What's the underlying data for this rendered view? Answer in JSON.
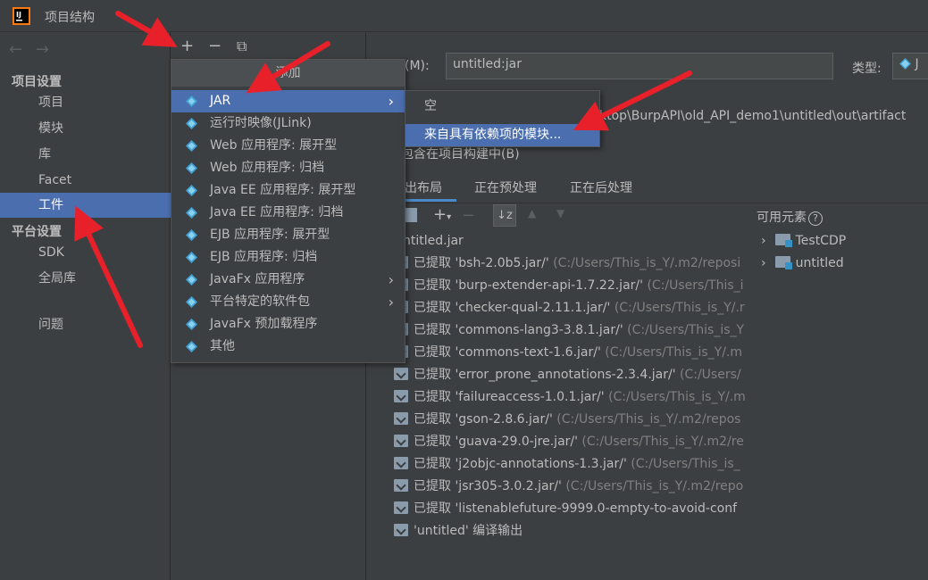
{
  "window": {
    "title": "项目结构"
  },
  "left": {
    "section1": "项目设置",
    "section2": "平台设置",
    "items1": [
      "项目",
      "模块",
      "库",
      "Facet",
      "工件"
    ],
    "items2": [
      "SDK",
      "全局库"
    ],
    "problems": "问题",
    "nav_back": "←",
    "nav_forward": "→"
  },
  "mid_toolbar": {
    "add": "+",
    "remove": "−",
    "copy": "⧉"
  },
  "right": {
    "name_label": "(M):",
    "name_mnemonic": "M",
    "name_value": "untitled:jar",
    "type_label": "类型:",
    "type_value": "J",
    "output_value": "ktop\\BurpAPI\\old_API_demo1\\untitled\\out\\artifact",
    "include_label": "包含在项目构建中",
    "include_key": "B",
    "tabs": [
      "出布局",
      "正在预处理",
      "正在后处理"
    ],
    "available_label": "可用元素",
    "root": "ntitled.jar",
    "rows": [
      {
        "name": "已提取 'bsh-2.0b5.jar/'",
        "path": "(C:/Users/This_is_Y/.m2/reposi"
      },
      {
        "name": "已提取 'burp-extender-api-1.7.22.jar/'",
        "path": "(C:/Users/This_i"
      },
      {
        "name": "已提取 'checker-qual-2.11.1.jar/'",
        "path": "(C:/Users/This_is_Y/.r"
      },
      {
        "name": "已提取 'commons-lang3-3.8.1.jar/'",
        "path": "(C:/Users/This_is_Y"
      },
      {
        "name": "已提取 'commons-text-1.6.jar/'",
        "path": "(C:/Users/This_is_Y/.m"
      },
      {
        "name": "已提取 'error_prone_annotations-2.3.4.jar/'",
        "path": "(C:/Users/"
      },
      {
        "name": "已提取 'failureaccess-1.0.1.jar/'",
        "path": "(C:/Users/This_is_Y/.m"
      },
      {
        "name": "已提取 'gson-2.8.6.jar/'",
        "path": "(C:/Users/This_is_Y/.m2/repos"
      },
      {
        "name": "已提取 'guava-29.0-jre.jar/'",
        "path": "(C:/Users/This_is_Y/.m2/re"
      },
      {
        "name": "已提取 'j2objc-annotations-1.3.jar/'",
        "path": "(C:/Users/This_is_"
      },
      {
        "name": "已提取 'jsr305-3.0.2.jar/'",
        "path": "(C:/Users/This_is_Y/.m2/repo"
      },
      {
        "name": "已提取 'listenablefuture-9999.0-empty-to-avoid-conf",
        "path": ""
      },
      {
        "name": "'untitled' 编译输出",
        "path": ""
      }
    ],
    "available": [
      "TestCDP",
      "untitled"
    ]
  },
  "menu": {
    "header": "添加",
    "items": [
      "JAR",
      "运行时映像(JLink)",
      "Web 应用程序: 展开型",
      "Web 应用程序: 归档",
      "Java EE 应用程序: 展开型",
      "Java EE 应用程序: 归档",
      "EJB 应用程序: 展开型",
      "EJB 应用程序: 归档",
      "JavaFx 应用程序",
      "平台特定的软件包",
      "JavaFx 预加载程序",
      "其他"
    ]
  },
  "submenu": {
    "items": [
      "空",
      "来自具有依赖项的模块..."
    ]
  },
  "colors": {
    "selection": "#4b6eaf",
    "arrow": "#e8202a",
    "background": "#3c3f41"
  }
}
